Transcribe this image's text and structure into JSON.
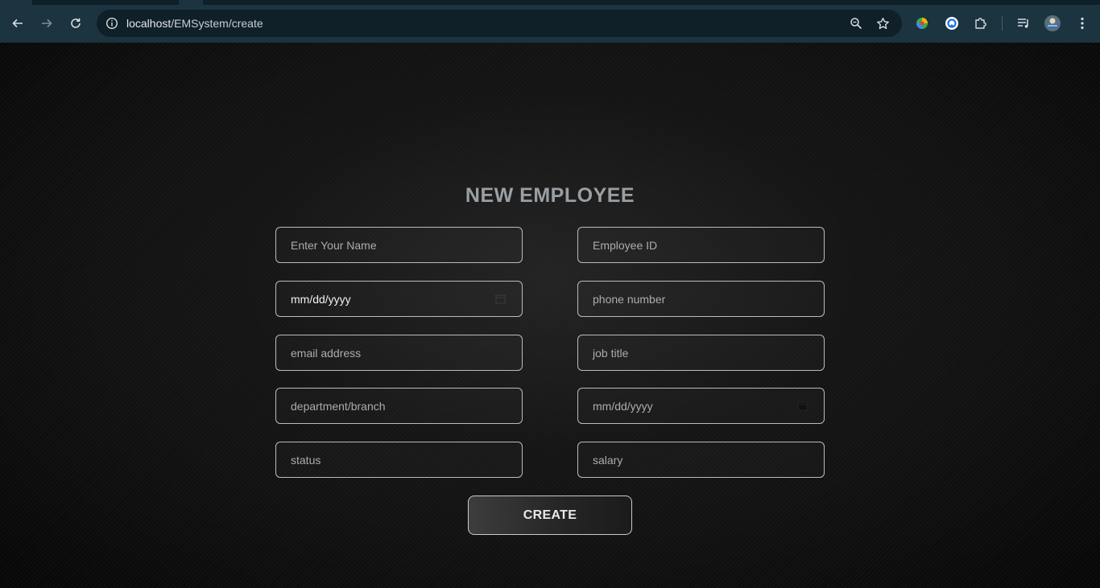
{
  "browser": {
    "url_host": "localhost",
    "url_path": "/EMSystem/create"
  },
  "form": {
    "title": "NEW EMPLOYEE",
    "fields": {
      "name": "Enter Your Name",
      "employee_id": "Employee ID",
      "birth_date": "mm/dd/yyyy",
      "phone": "phone number",
      "email": "email address",
      "job_title": "job title",
      "department": "department/branch",
      "hire_date": "mm/dd/yyyy",
      "status": "status",
      "salary": "salary"
    },
    "submit_label": "CREATE"
  },
  "icons": {
    "back": "arrow-left-icon",
    "forward": "arrow-right-icon",
    "reload": "reload-icon",
    "site_info": "info-icon",
    "zoom": "zoom-icon",
    "bookmark": "star-icon",
    "extension_1": "colorful-extension-icon",
    "extension_2": "circle-extension-icon",
    "extensions": "puzzle-icon",
    "media": "media-control-icon",
    "profile": "avatar-icon",
    "menu": "kebab-menu-icon"
  },
  "colors": {
    "toolbar_bg": "#1c3340",
    "omnibox_bg": "#0f2029",
    "page_bg": "#121212",
    "title_color": "#9a9fa3",
    "field_border": "#b9bcbe"
  }
}
